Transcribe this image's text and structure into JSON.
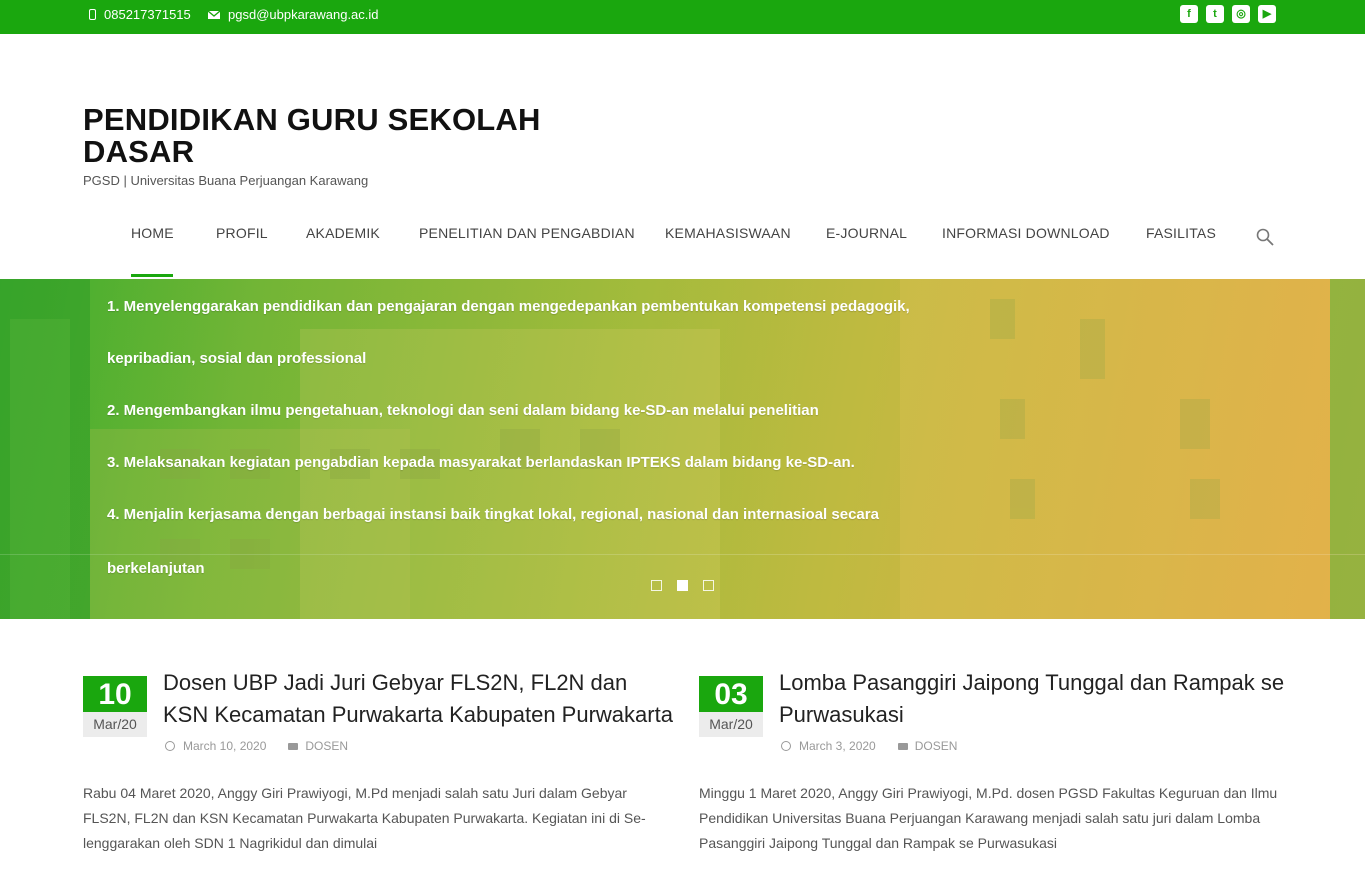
{
  "topbar": {
    "phone": "085217371515",
    "email": "pgsd@ubpkarawang.ac.id",
    "social_icons": [
      "facebook-icon",
      "twitter-icon",
      "instagram-icon",
      "youtube-icon"
    ],
    "social_glyphs": [
      "f",
      "t",
      "◎",
      "▶"
    ]
  },
  "header": {
    "title": "PENDIDIKAN GURU SEKOLAH DASAR",
    "tagline": "PGSD | Universitas Buana Perjuangan Karawang"
  },
  "nav": {
    "items": [
      "HOME",
      "PROFIL",
      "AKADEMIK",
      "PENELITIAN DAN PENGABDIAN",
      "KEMAHASISWAAN",
      "E-JOURNAL",
      "INFORMASI DOWNLOAD",
      "FASILITAS"
    ],
    "active": "HOME"
  },
  "slider": {
    "lines": [
      "1. Menyelenggarakan pendidikan dan pengajaran dengan mengedepankan pembentukan kompetensi pedagogik,",
      "kepribadian, sosial dan professional",
      "2. Mengembangkan ilmu pengetahuan, teknologi dan seni dalam bidang ke-SD-an melalui penelitian",
      "3. Melaksanakan kegiatan pengabdian kepada masyarakat berlandaskan IPTEKS dalam bidang ke-SD-an.",
      "4. Menjalin kerjasama dengan berbagai instansi baik tingkat lokal, regional, nasional dan internasioal secara",
      "berkelanjutan"
    ],
    "slide_count": 3,
    "active_slide": 2
  },
  "posts": [
    {
      "day": "10",
      "month": "Mar/20",
      "title": "Dosen UBP Jadi Juri Gebyar FLS2N, FL2N dan KSN Kecamatan Purwakarta Kabupaten Purwakarta",
      "date": "March 10, 2020",
      "category": "DOSEN",
      "excerpt": "Rabu 04 Maret 2020, Anggy Giri Prawiyogi, M.Pd menjadi salah satu Juri dalam Gebyar FLS2N, FL2N dan KSN Kecamatan Purwakarta Kabupaten Purwakarta. Kegiatan ini di Se-lenggarakan oleh SDN 1 Nagrikidul dan dimulai"
    },
    {
      "day": "03",
      "month": "Mar/20",
      "title": "Lomba Pasanggiri Jaipong Tunggal dan Rampak se Purwasukasi",
      "date": "March 3, 2020",
      "category": "DOSEN",
      "excerpt": "Minggu 1 Maret 2020, Anggy Giri Prawiyogi, M.Pd. dosen PGSD Fakultas Keguruan dan Ilmu Pendidikan Universitas Buana Perjuangan Karawang menjadi salah satu juri dalam Lomba Pasanggiri Jaipong Tunggal dan Rampak se Purwasukasi"
    }
  ],
  "colors": {
    "brand": "#1aa70e",
    "date_bg": "#ececec"
  }
}
